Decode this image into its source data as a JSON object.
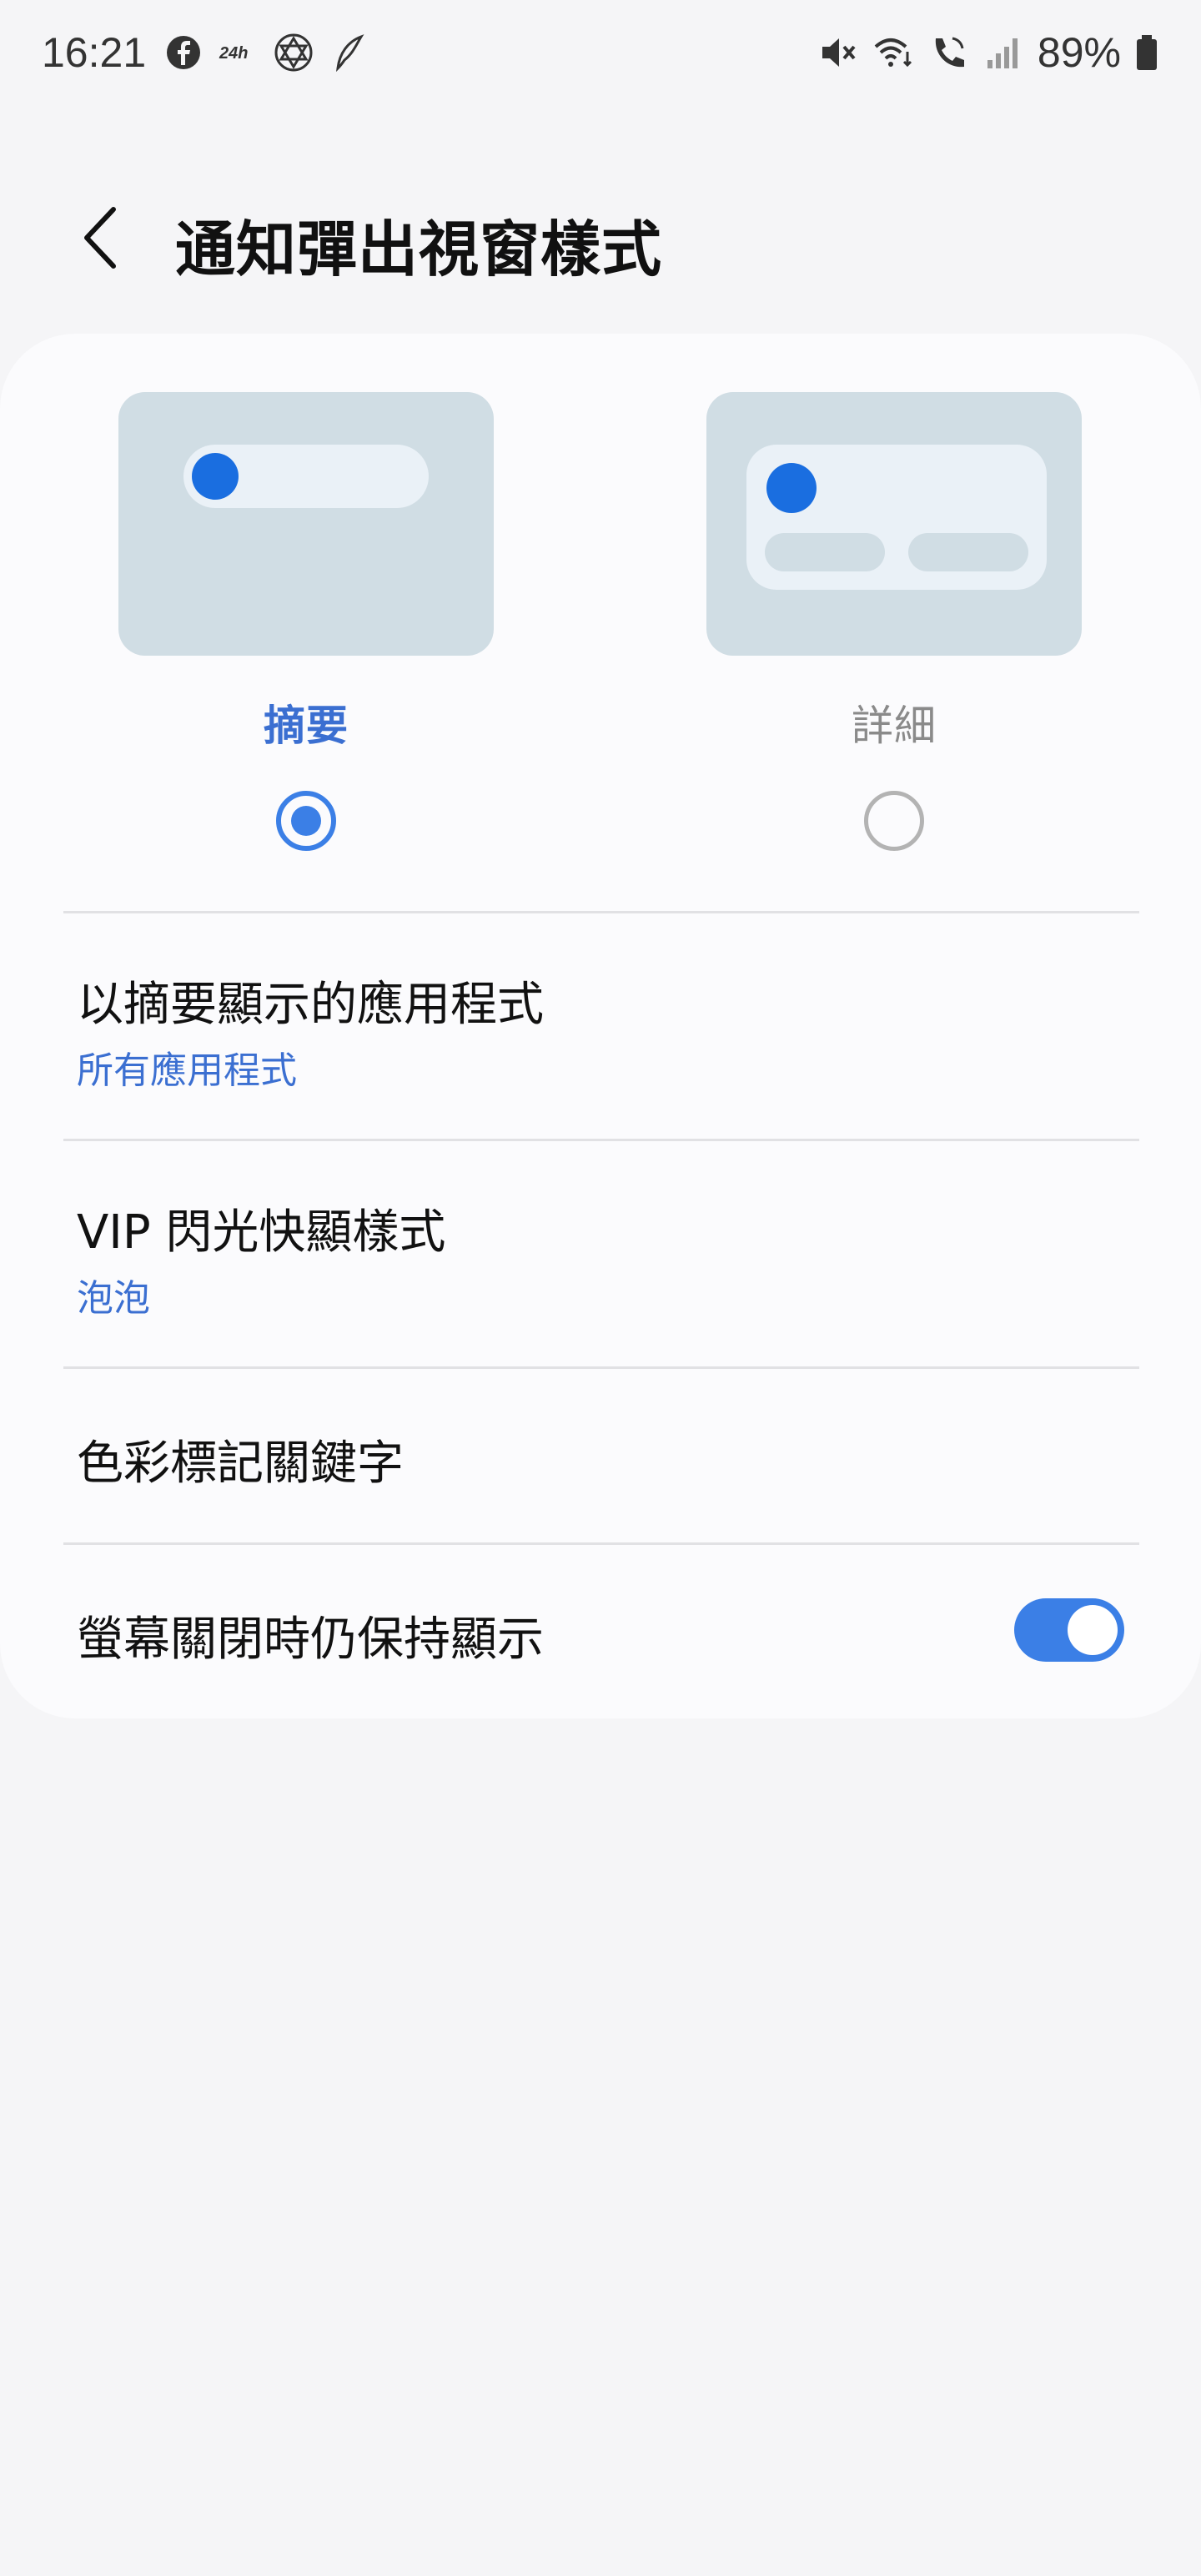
{
  "status_bar": {
    "time": "16:21",
    "left_icons": [
      "facebook-icon",
      "24h-news-icon",
      "star-of-david-icon",
      "feather-app-icon"
    ],
    "right_icons": [
      "mute-icon",
      "wifi-calling-icon",
      "call-icon",
      "signal-icon"
    ],
    "battery_text": "89%",
    "battery_icon": "battery-icon"
  },
  "header": {
    "back_icon": "chevron-left-icon",
    "title": "通知彈出視窗樣式"
  },
  "style_options": [
    {
      "label": "摘要",
      "selected": true,
      "preview": "brief"
    },
    {
      "label": "詳細",
      "selected": false,
      "preview": "detailed"
    }
  ],
  "rows": [
    {
      "title": "以摘要顯示的應用程式",
      "subtitle": "所有應用程式"
    },
    {
      "title": "VIP 閃光快顯樣式",
      "subtitle": "泡泡"
    },
    {
      "title": "色彩標記關鍵字"
    },
    {
      "title": "螢幕關閉時仍保持顯示",
      "toggle": true
    }
  ],
  "colors": {
    "accent": "#3b7fe6",
    "accent_text": "#3b6fd1",
    "preview_bg": "#d0dde4",
    "preview_dot": "#1a6ee0"
  }
}
